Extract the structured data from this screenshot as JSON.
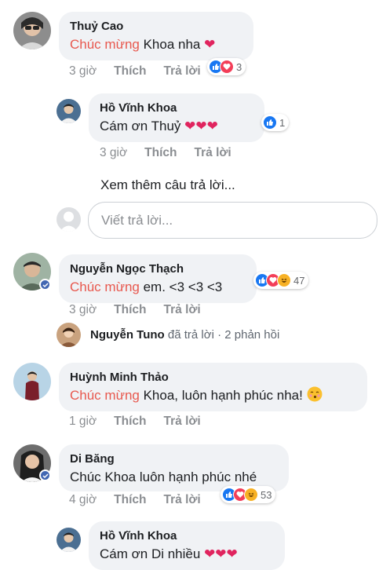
{
  "comments": [
    {
      "name": "Thuỷ Cao",
      "highlight": "Chúc mừng",
      "text": " Khoa nha",
      "time": "3 giờ",
      "like": "Thích",
      "reply": "Trả lời",
      "reaction_count": "3"
    },
    {
      "name": "Hồ Vĩnh Khoa",
      "text": "Cám ơn Thuỷ",
      "time": "3 giờ",
      "like": "Thích",
      "reply": "Trả lời",
      "reaction_count": "1"
    },
    {
      "name": "Nguyễn Ngọc Thạch",
      "highlight": "Chúc mừng",
      "text": " em. <3 <3 <3",
      "time": "3 giờ",
      "like": "Thích",
      "reply": "Trả lời",
      "reaction_count": "47"
    },
    {
      "name": "Huỳnh Minh Thảo",
      "highlight": "Chúc mừng",
      "text": " Khoa, luôn hạnh phúc nha!",
      "time": "1 giờ",
      "like": "Thích",
      "reply": "Trả lời"
    },
    {
      "name": "Di Băng",
      "text": "Chúc Khoa luôn hạnh phúc nhé",
      "time": "4 giờ",
      "like": "Thích",
      "reply": "Trả lời",
      "reaction_count": "53"
    },
    {
      "name": "Hồ Vĩnh Khoa",
      "text": "Cám ơn Di nhiều"
    }
  ],
  "more_replies": "Xem thêm câu trả lời...",
  "reply_input": {
    "placeholder": "Viết trả lời..."
  },
  "reply_summary": {
    "name": "Nguyễn Tuno",
    "action": " đã trả lời",
    "dot": " · ",
    "count": "2 phản hồi"
  },
  "colors": {
    "highlight": "#e8584e",
    "like": "#1877f2",
    "love": "#f33e58",
    "haha": "#f7b125"
  }
}
